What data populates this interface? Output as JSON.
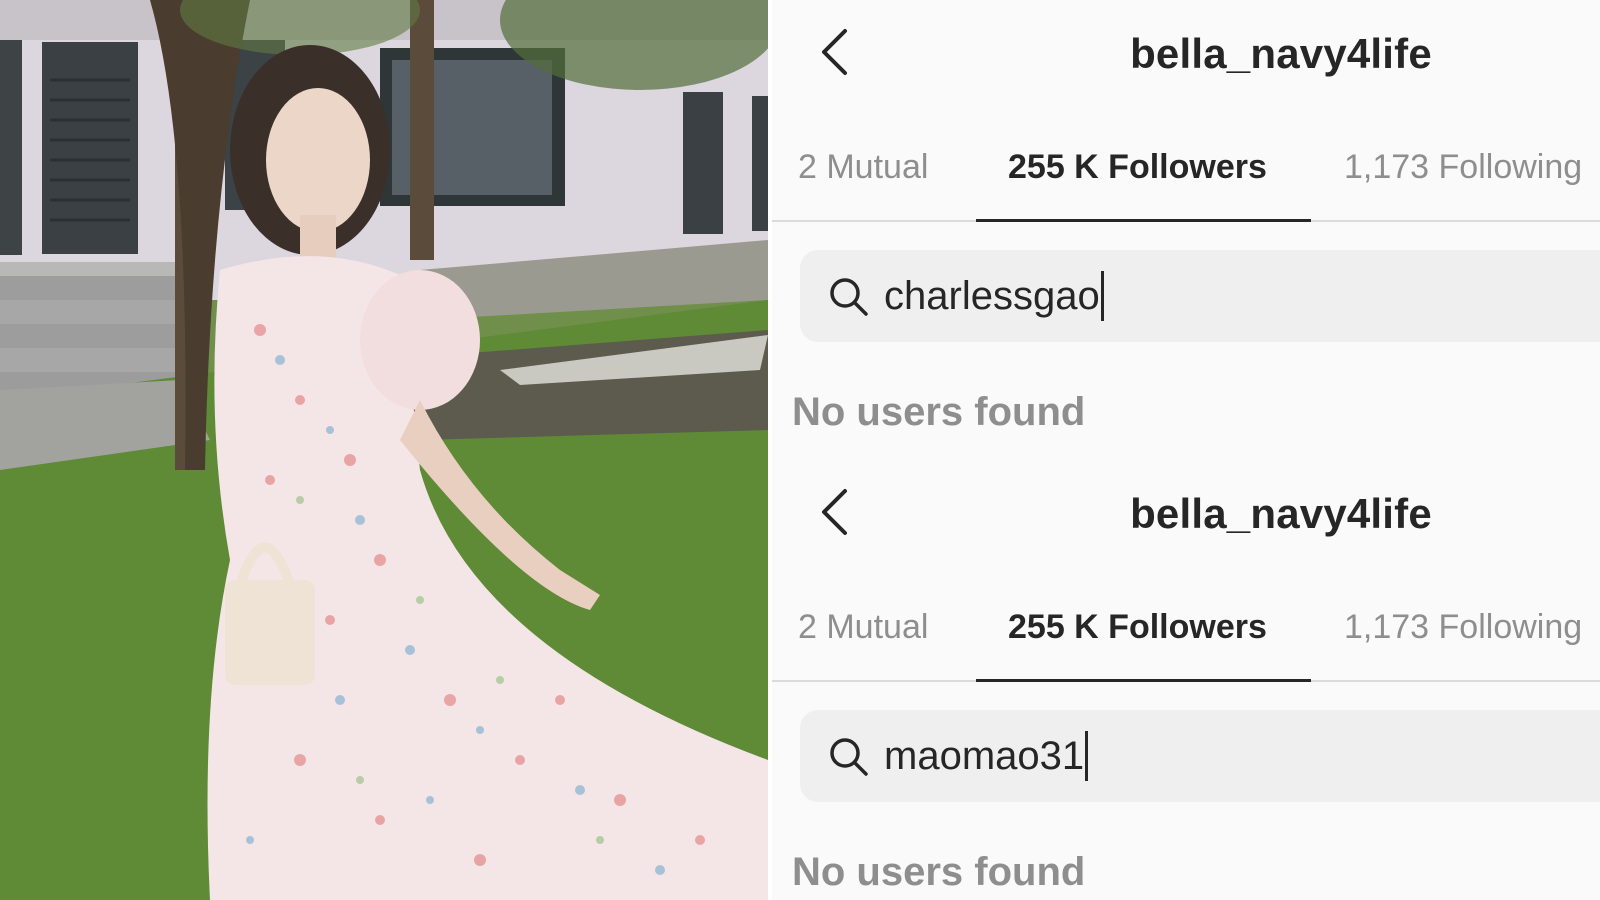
{
  "screens": [
    {
      "username": "bella_navy4life",
      "tabs": [
        {
          "label": "2 Mutual",
          "active": false
        },
        {
          "label": "255 K Followers",
          "active": true
        },
        {
          "label": "1,173 Following",
          "active": false
        }
      ],
      "search_value": "charlessgao",
      "empty_message": "No users found"
    },
    {
      "username": "bella_navy4life",
      "tabs": [
        {
          "label": "2 Mutual",
          "active": false
        },
        {
          "label": "255 K Followers",
          "active": true
        },
        {
          "label": "1,173 Following",
          "active": false
        }
      ],
      "search_value": "maomao31",
      "empty_message": "No users found"
    }
  ],
  "colors": {
    "text_primary": "#262626",
    "text_secondary": "#8e8e8e",
    "search_bg": "#efefef",
    "screen_bg": "#fafafa"
  },
  "icons": [
    "chevron-left-icon",
    "search-icon"
  ]
}
